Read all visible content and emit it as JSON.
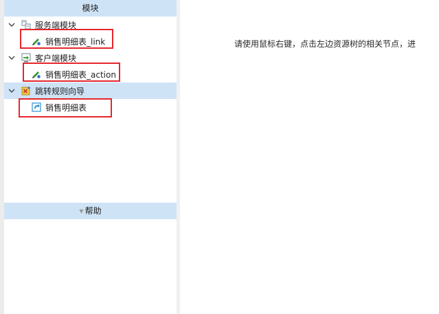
{
  "sidebar": {
    "modules_header": "模块",
    "help_header": "帮助",
    "tree": [
      {
        "label": "服务端模块",
        "icon": "server-module-icon",
        "children": [
          {
            "label": "销售明细表_link",
            "icon": "link-pencil-icon"
          }
        ]
      },
      {
        "label": "客户端模块",
        "icon": "client-module-icon",
        "children": [
          {
            "label": "销售明细表_action",
            "icon": "action-pencil-icon"
          }
        ]
      },
      {
        "label": "跳转规则向导",
        "icon": "jump-rule-wizard-icon",
        "children": [
          {
            "label": "销售明细表",
            "icon": "jump-rule-icon"
          }
        ]
      }
    ]
  },
  "main": {
    "message": "请使用鼠标右键，点击左边资源树的相关节点，进"
  },
  "colors": {
    "header_bg": "#cfe3f6",
    "selected_bg": "#cfe3f6",
    "highlight_box": "#e5262c"
  }
}
